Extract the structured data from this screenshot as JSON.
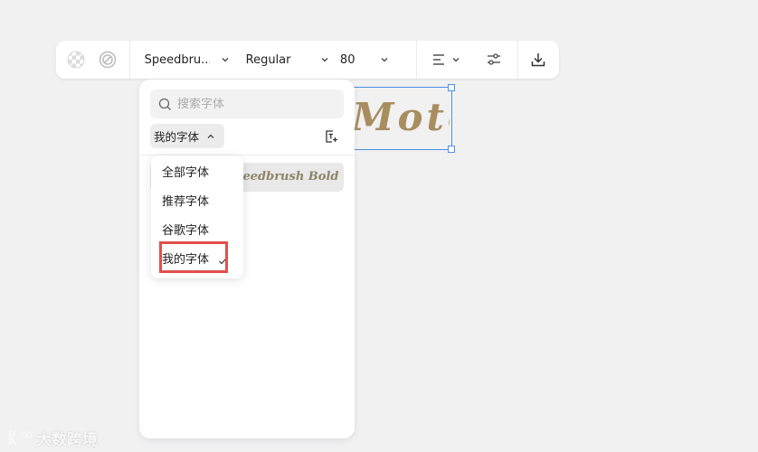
{
  "toolbar": {
    "font_name": "Speedbru...",
    "font_weight": "Regular",
    "font_size": "80"
  },
  "canvas": {
    "text": "Moto"
  },
  "font_panel": {
    "search_placeholder": "搜索字体",
    "category_label": "我的字体",
    "font_row_text": "Speedbrush Bold"
  },
  "category_menu": {
    "items": [
      "全部字体",
      "推荐字体",
      "谷歌字体",
      "我的字体"
    ],
    "selected": "我的字体"
  },
  "watermark": {
    "text": "大数跨境"
  },
  "colors": {
    "selection_border": "#4a90e2",
    "highlight_box": "#e0504a",
    "font_sample": "#a88d5f"
  }
}
